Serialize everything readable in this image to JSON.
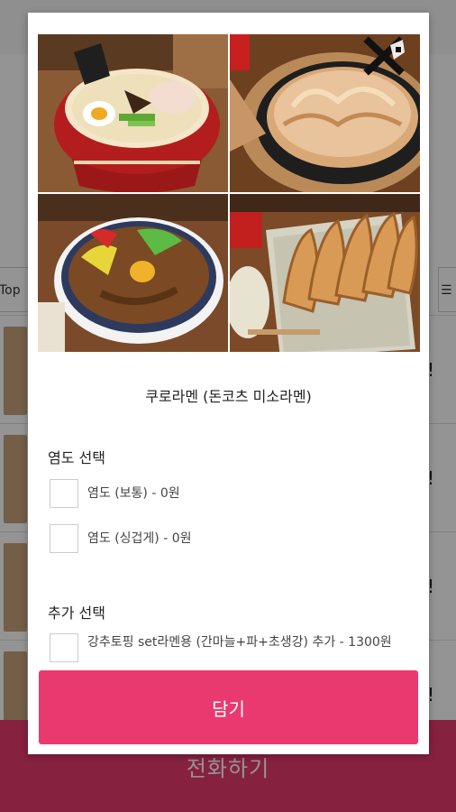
{
  "background": {
    "tab_left_label": "Top",
    "tab_right_label": "☰",
    "list_mark": "!",
    "footer_label": "전화하기"
  },
  "modal": {
    "close_icon": "close-x-icon",
    "photos": [
      {
        "icon": "ramen-bowl-photo"
      },
      {
        "icon": "okonomiyaki-photo"
      },
      {
        "icon": "rice-bowl-photo"
      },
      {
        "icon": "gyoza-photo"
      }
    ],
    "menu_title": "쿠로라멘 (돈코츠 미소라멘)",
    "salt_section": {
      "title": "염도 선택",
      "options": [
        {
          "label": "염도 (보통) - 0원",
          "checked": false
        },
        {
          "label": "염도 (싱겁게) - 0원",
          "checked": false
        }
      ]
    },
    "extra_section": {
      "title": "추가 선택",
      "options": [
        {
          "label": "강추토핑 set라멘용 (간마늘+파+초생강) 추가 - 1300원",
          "checked": false
        }
      ]
    },
    "cart_button_label": "담기"
  },
  "colors": {
    "accent": "#e9396f",
    "overlay": "rgba(0,0,0,0.42)"
  }
}
